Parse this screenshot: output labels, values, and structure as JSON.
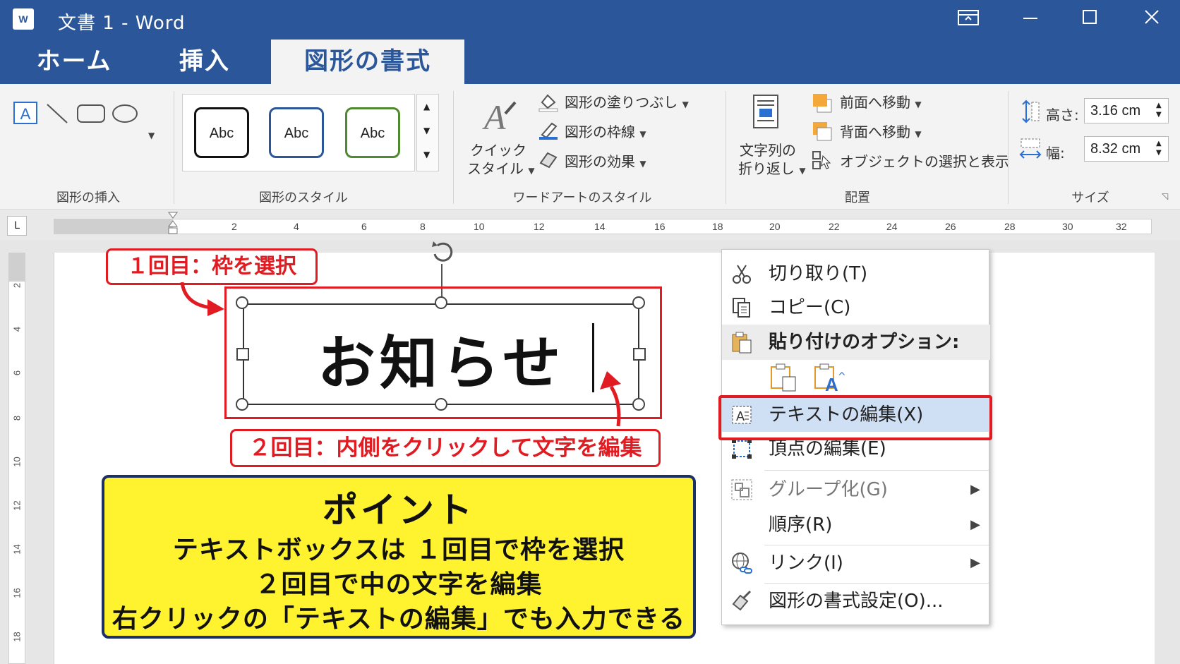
{
  "window": {
    "logo": "W",
    "title": "文書 1 - Word",
    "buttons": [
      "restore-ribbon",
      "minimize",
      "maximize",
      "close"
    ]
  },
  "tabs": [
    {
      "label": "ホーム",
      "active": false
    },
    {
      "label": "挿入",
      "active": false
    },
    {
      "label": "図形の書式",
      "active": true
    }
  ],
  "ribbon": {
    "insert_shapes": {
      "label": "図形の挿入",
      "shapes": [
        "text-box-icon",
        "line-icon",
        "rounded-rect-icon",
        "oval-icon"
      ]
    },
    "shape_styles": {
      "label": "図形のスタイル",
      "samples": [
        "Abc",
        "Abc",
        "Abc"
      ],
      "sample_colors": [
        "#111111",
        "#2b579a",
        "#4e8a2e"
      ]
    },
    "wordart": {
      "label": "ワードアートのスタイル",
      "quick_style_line1": "クイック",
      "quick_style_line2": "スタイル",
      "fill": "図形の塗りつぶし",
      "outline": "図形の枠線",
      "effects": "図形の効果"
    },
    "arrange": {
      "label": "配置",
      "wrap_line1": "文字列の",
      "wrap_line2": "折り返し",
      "bring_forward": "前面へ移動",
      "send_backward": "背面へ移動",
      "selection_pane": "オブジェクトの選択と表示"
    },
    "size": {
      "label": "サイズ",
      "height_label": "高さ:",
      "height_value": "3.16 cm",
      "width_label": "幅:",
      "width_value": "8.32 cm"
    }
  },
  "ruler": {
    "tab_button": "L",
    "numbers": [
      "2",
      "4",
      "6",
      "8",
      "10",
      "12",
      "14",
      "16",
      "18",
      "20",
      "22",
      "24",
      "26",
      "28",
      "30",
      "32"
    ],
    "vertical_numbers": [
      "2",
      "4",
      "6",
      "8",
      "10",
      "12",
      "14",
      "16",
      "18"
    ]
  },
  "document": {
    "textbox_text": "お知らせ",
    "callout_1": "１回目：枠を選択",
    "callout_2": "２回目：内側をクリックして文字を編集",
    "point": {
      "title": "ポイント",
      "line1": "テキストボックスは １回目で枠を選択",
      "line2": "２回目で中の文字を編集",
      "line3": "右クリックの「テキストの編集」でも入力できる"
    }
  },
  "context_menu": {
    "items": [
      {
        "label": "切り取り(T)",
        "icon": "scissors-icon"
      },
      {
        "label": "コピー(C)",
        "icon": "copy-icon"
      },
      {
        "label": "貼り付けのオプション:",
        "icon": "paste-icon"
      },
      {
        "label": "テキストの編集(X)",
        "icon": "edit-text-icon"
      },
      {
        "label": "頂点の編集(E)",
        "icon": "edit-points-icon"
      },
      {
        "label": "グループ化(G)",
        "icon": "group-icon"
      },
      {
        "label": "順序(R)",
        "icon": ""
      },
      {
        "label": "リンク(I)",
        "icon": "link-icon"
      },
      {
        "label": "図形の書式設定(O)...",
        "icon": "format-shape-icon"
      }
    ],
    "submenu_arrow": "▶"
  },
  "colors": {
    "word_blue": "#2b579a",
    "callout_red": "#e11b22",
    "point_yellow": "#fff22e",
    "point_border": "#1e2f66",
    "menu_highlight": "#cfe0f5"
  }
}
